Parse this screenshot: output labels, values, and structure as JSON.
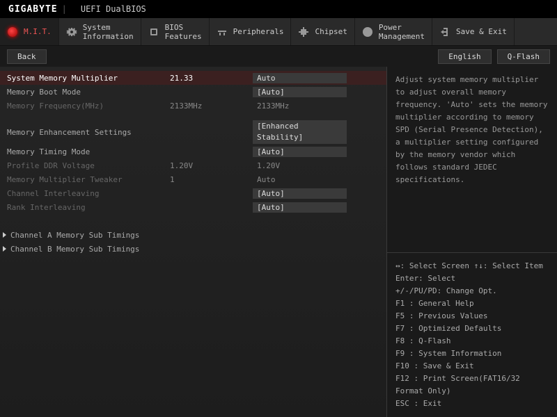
{
  "header": {
    "brand": "GIGABYTE",
    "sub": "UEFI DualBIOS"
  },
  "tabs": [
    {
      "label": "M.I.T."
    },
    {
      "label": "System\nInformation"
    },
    {
      "label": "BIOS\nFeatures"
    },
    {
      "label": "Peripherals"
    },
    {
      "label": "Chipset"
    },
    {
      "label": "Power\nManagement"
    },
    {
      "label": "Save & Exit"
    }
  ],
  "toolbar": {
    "back": "Back",
    "lang": "English",
    "qflash": "Q-Flash"
  },
  "rows": {
    "mem_mult": {
      "label": "System Memory Multiplier",
      "val": "21.33",
      "input": "Auto"
    },
    "boot_mode": {
      "label": "Memory Boot Mode",
      "val": "",
      "input": "[Auto]"
    },
    "mem_freq": {
      "label": "Memory Frequency(MHz)",
      "val": "2133MHz",
      "static": "2133MHz"
    },
    "enh": {
      "label": "Memory Enhancement Settings",
      "val": "",
      "input": "[Enhanced Stability]"
    },
    "timing_mode": {
      "label": "Memory Timing Mode",
      "val": "",
      "input": "[Auto]"
    },
    "ddr_volt": {
      "label": "Profile DDR Voltage",
      "val": "1.20V",
      "static": "1.20V"
    },
    "mult_tweak": {
      "label": "Memory Multiplier Tweaker",
      "val": "1",
      "static": "Auto"
    },
    "ch_interleave": {
      "label": "Channel Interleaving",
      "val": "",
      "input": "[Auto]"
    },
    "rank_interleave": {
      "label": "Rank Interleaving",
      "val": "",
      "input": "[Auto]"
    }
  },
  "subs": [
    "Channel A Memory Sub Timings",
    "Channel B Memory Sub Timings"
  ],
  "help": "Adjust system memory multiplier to adjust overall memory frequency. 'Auto' sets the memory multiplier according to memory SPD (Serial Presence Detection), a multiplier setting configured by the memory vendor which follows standard JEDEC specifications.",
  "keys": "↔: Select Screen   ↑↓: Select Item\nEnter: Select\n+/-/PU/PD: Change Opt.\nF1  : General Help\nF5  : Previous Values\nF7  : Optimized Defaults\nF8  : Q-Flash\nF9  : System Information\nF10 : Save & Exit\nF12 : Print Screen(FAT16/32 Format Only)\nESC : Exit"
}
